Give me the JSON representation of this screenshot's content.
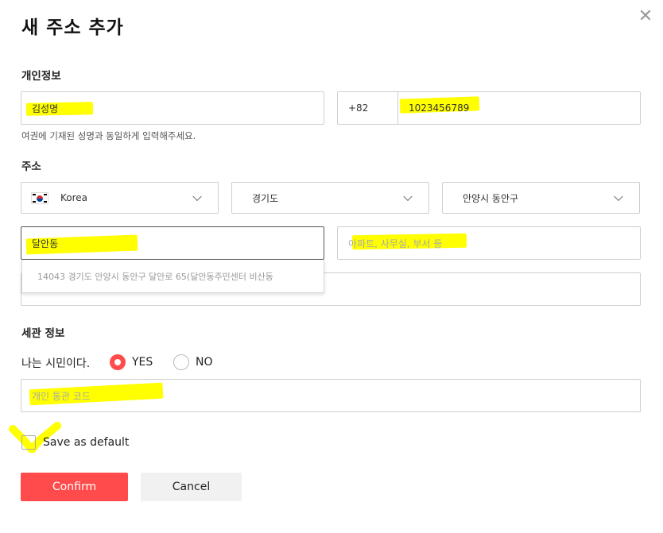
{
  "dialog": {
    "title": "새 주소 추가",
    "close_icon": "close-icon"
  },
  "personal": {
    "section_title": "개인정보",
    "name_value": "김성명",
    "country_code": "+82",
    "phone_value": "1023456789",
    "helper_text": "여권에 기재된 성명과 동일하게 입력해주세요."
  },
  "address": {
    "section_title": "주소",
    "country": "Korea",
    "province": "경기도",
    "city": "안양시 동안구",
    "street_value": "달안동",
    "detail_placeholder": "아파트, 사무실, 부서 등",
    "suggestion": "14043 경기도 안양시 동안구 달안로 65(달안동주민센터 비산동"
  },
  "customs": {
    "section_title": "세관 정보",
    "citizen_question": "나는 시민이다.",
    "yes_label": "YES",
    "no_label": "NO",
    "customs_code_placeholder": "개인 통관 코드"
  },
  "footer": {
    "save_default_label": "Save as default",
    "confirm_label": "Confirm",
    "cancel_label": "Cancel"
  },
  "colors": {
    "accent": "#ff4b4b",
    "highlight": "#ffff00"
  }
}
